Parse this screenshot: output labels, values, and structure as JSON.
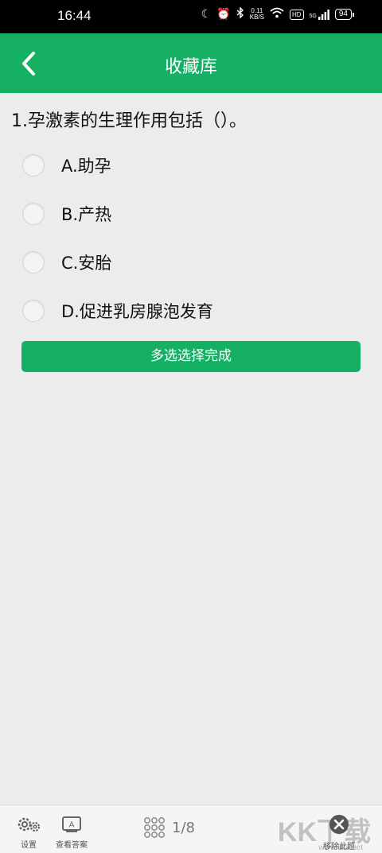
{
  "status_bar": {
    "time": "16:44",
    "net_speed_value": "0.11",
    "net_speed_unit": "KB/S",
    "hd_badge": "HD",
    "signal_label": "5G",
    "battery": "94"
  },
  "header": {
    "title": "收藏库",
    "back_icon": "chevron-left-icon"
  },
  "question": {
    "text": "1.孕激素的生理作用包括（）。",
    "options": [
      {
        "label": "A.助孕"
      },
      {
        "label": "B.产热"
      },
      {
        "label": "C.安胎"
      },
      {
        "label": "D.促进乳房腺泡发育"
      }
    ],
    "submit_label": "多选选择完成"
  },
  "bottom_bar": {
    "settings_label": "设置",
    "answer_label": "查看答案",
    "answer_icon_letter": "A",
    "page_indicator": "1/8",
    "remove_label": "移除此题",
    "watermark": "KK下载",
    "watermark_url": "www.kkx.net"
  },
  "colors": {
    "accent": "#15b063",
    "background": "#ececec"
  }
}
